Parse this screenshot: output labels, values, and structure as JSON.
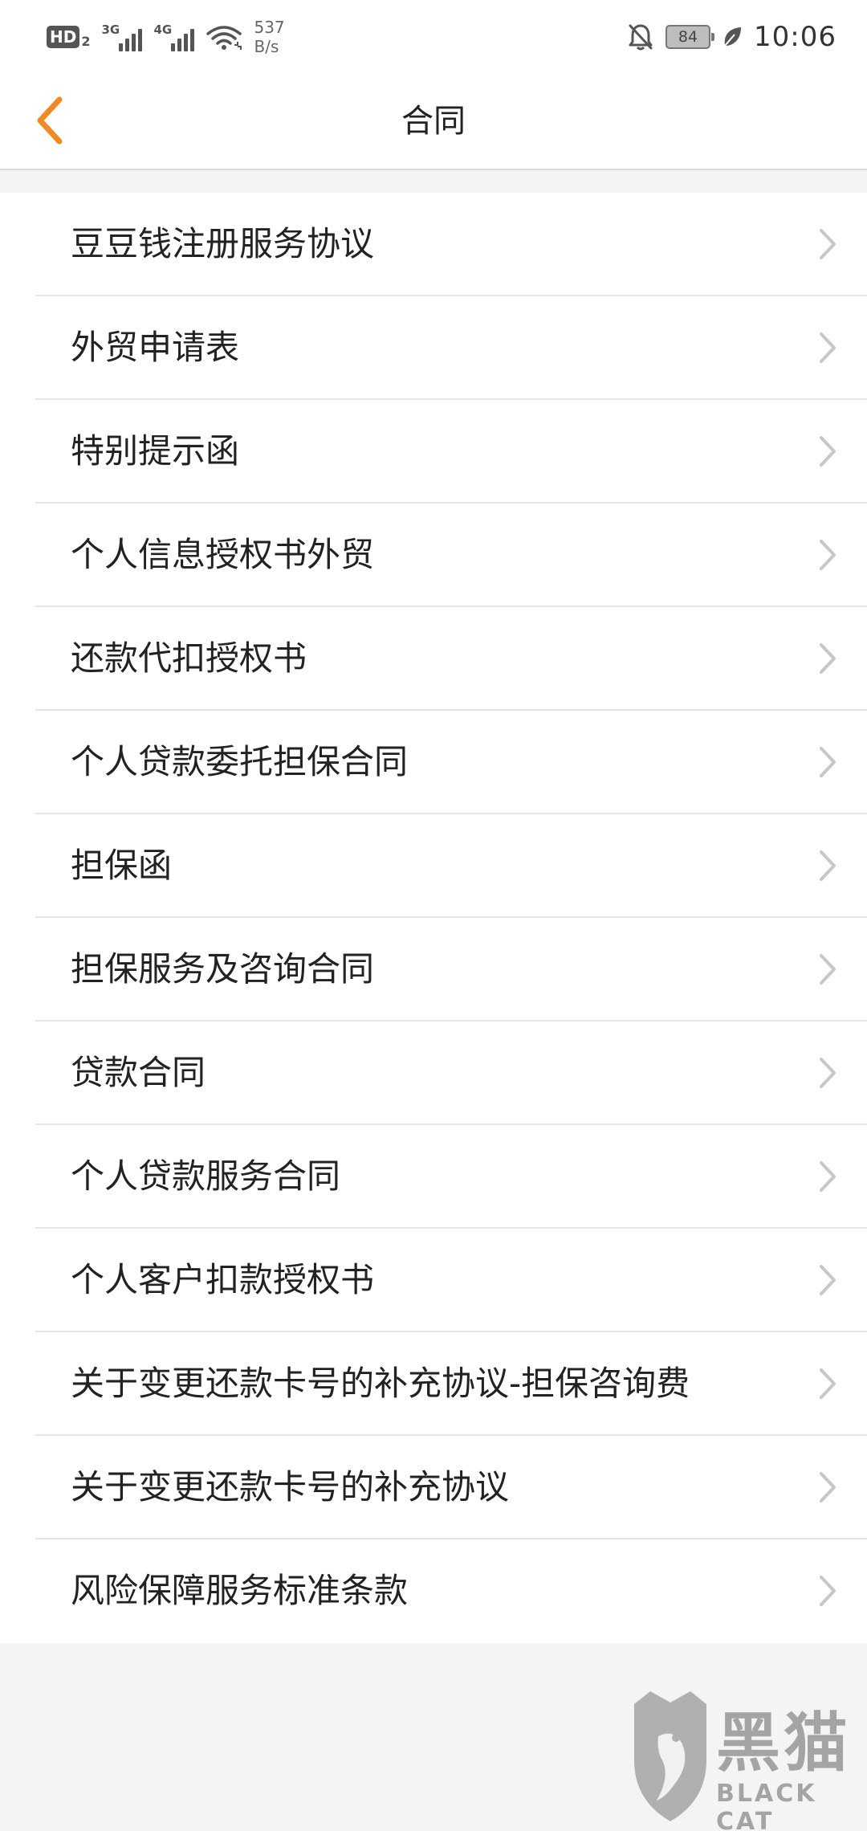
{
  "status_bar": {
    "hd_label": "HD",
    "hd_sub": "2",
    "net1": "3G",
    "net2": "4G",
    "speed_value": "537",
    "speed_unit": "B/s",
    "battery": "84",
    "time": "10:06"
  },
  "nav": {
    "title": "合同"
  },
  "contracts": [
    {
      "label": "豆豆钱注册服务协议"
    },
    {
      "label": "外贸申请表"
    },
    {
      "label": "特别提示函"
    },
    {
      "label": "个人信息授权书外贸"
    },
    {
      "label": "还款代扣授权书"
    },
    {
      "label": "个人贷款委托担保合同"
    },
    {
      "label": "担保函"
    },
    {
      "label": "担保服务及咨询合同"
    },
    {
      "label": "贷款合同"
    },
    {
      "label": "个人贷款服务合同"
    },
    {
      "label": "个人客户扣款授权书"
    },
    {
      "label": "关于变更还款卡号的补充协议-担保咨询费"
    },
    {
      "label": "关于变更还款卡号的补充协议"
    },
    {
      "label": "风险保障服务标准条款"
    }
  ],
  "watermark": {
    "main": "黑猫",
    "sub": "BLACK CAT"
  },
  "colors": {
    "accent": "#f08a24",
    "chevron": "#c7c7c7",
    "background": "#f4f4f4"
  },
  "icons": {
    "back": "chevron-left-icon",
    "row_arrow": "chevron-right-icon",
    "mute": "bell-off-icon",
    "eco": "leaf-icon"
  }
}
